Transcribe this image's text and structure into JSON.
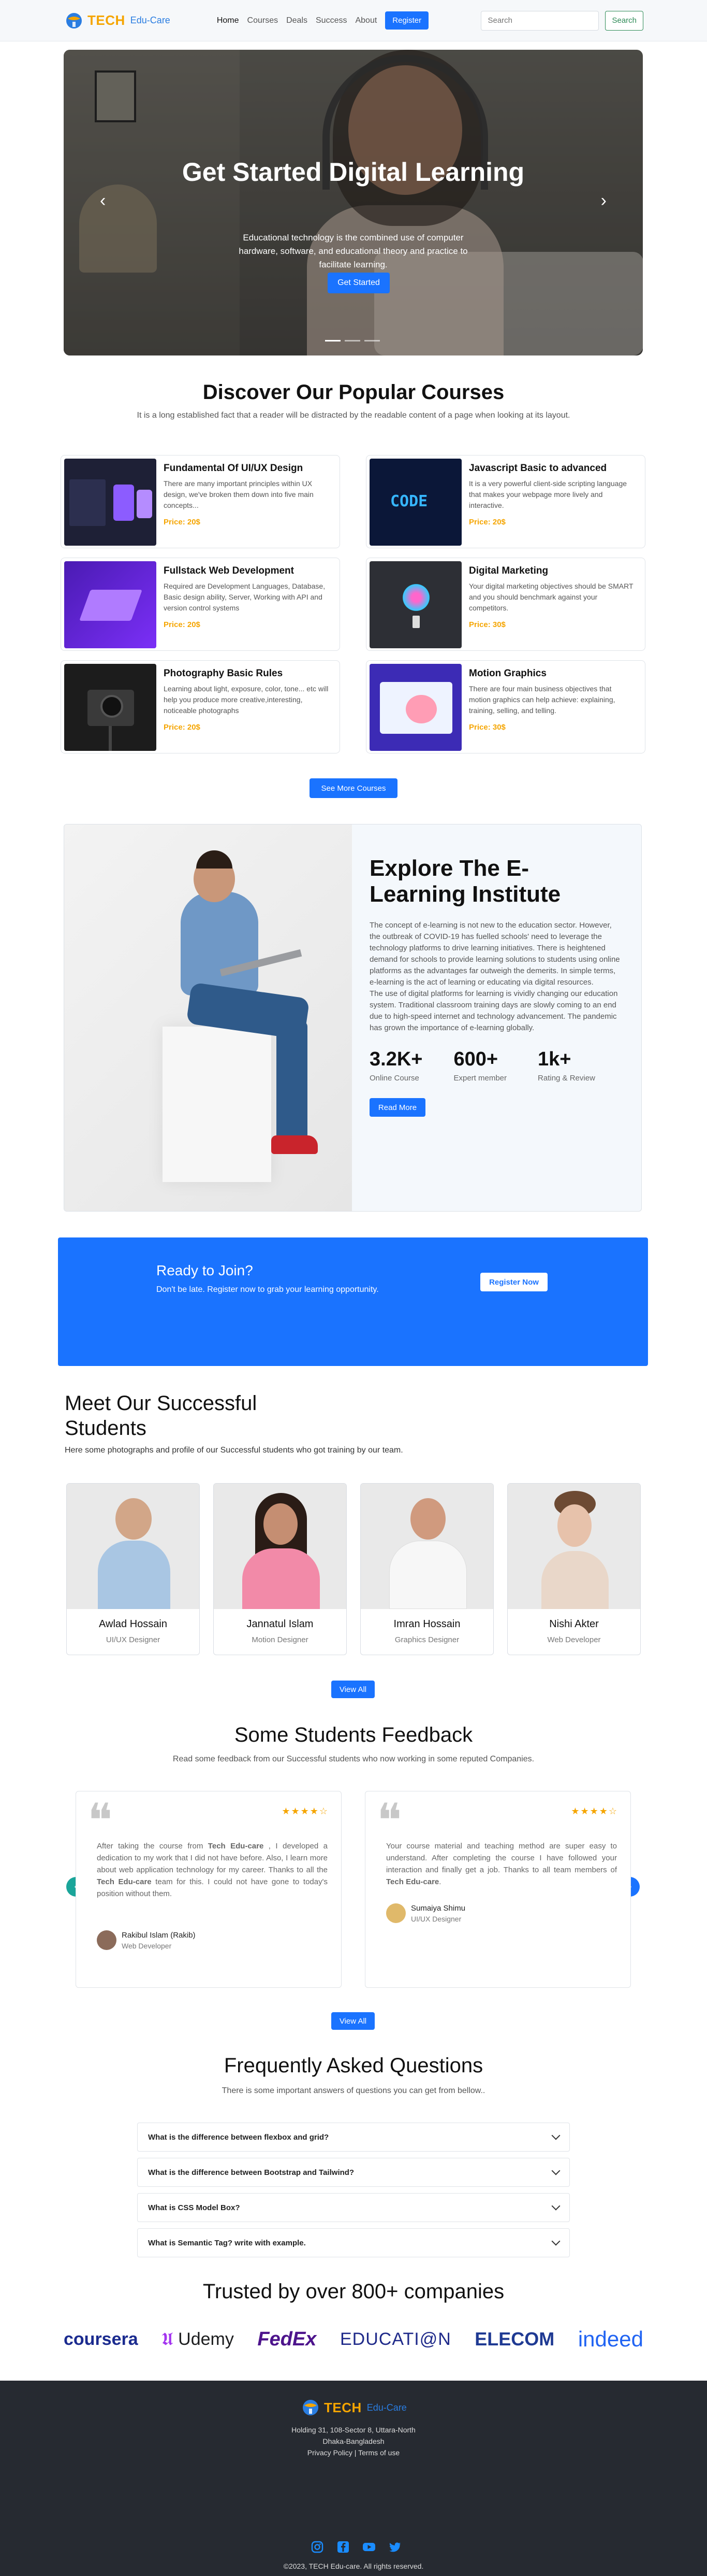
{
  "nav": {
    "logo_text": "TECH",
    "logo_sub": "Edu-Care",
    "links": [
      "Home",
      "Courses",
      "Deals",
      "Success",
      "About"
    ],
    "register": "Register",
    "search_placeholder": "Search",
    "search_button": "Search"
  },
  "hero": {
    "title": "Get Started Digital Learning",
    "text": "Educational technology is the combined use of computer hardware, software, and educational theory and practice to facilitate learning.",
    "cta": "Get Started"
  },
  "courses": {
    "title": "Discover Our Popular Courses",
    "subtitle": "It is a long established fact that a reader will be distracted by the readable content of a page when looking at its layout.",
    "items": [
      {
        "title": "Fundamental Of UI/UX Design",
        "desc": "There are many important principles within UX design, we've broken them down into five main concepts...",
        "price": "Price: 20$"
      },
      {
        "title": "Javascript Basic to advanced",
        "desc": "It is a very powerful client-side scripting language that makes your webpage more lively and interactive.",
        "price": "Price: 20$"
      },
      {
        "title": "Fullstack Web Development",
        "desc": "Required are Development Languages, Database, Basic design ability, Server, Working with API and version control systems",
        "price": "Price: 20$"
      },
      {
        "title": "Digital Marketing",
        "desc": "Your digital marketing objectives should be SMART and you should benchmark against your competitors.",
        "price": "Price: 30$"
      },
      {
        "title": "Photography Basic Rules",
        "desc": "Learning about light, exposure, color, tone... etc will help you produce more creative,interesting, noticeable photographs",
        "price": "Price: 20$"
      },
      {
        "title": "Motion Graphics",
        "desc": "There are four main business objectives that motion graphics can help achieve: explaining, training, selling, and telling.",
        "price": "Price: 30$"
      }
    ],
    "thumb_code_label": "CODE",
    "more": "See More Courses"
  },
  "elearn": {
    "title": "Explore The E-Learning Institute",
    "text": "The concept of e-learning is not new to the education sector. However, the outbreak of COVID-19 has fuelled schools' need to leverage the technology platforms to drive learning initiatives. There is heightened demand for schools to provide learning solutions to students using online platforms as the advantages far outweigh the demerits. In simple terms, e-learning is the act of learning or educating via digital resources.",
    "text2": "The use of digital platforms for learning is vividly changing our education system. Traditional classroom training days are slowly coming to an end due to high-speed internet and technology advancement. The pandemic has grown the importance of e-learning globally.",
    "stats": [
      {
        "n": "3.2K+",
        "l": "Online Course"
      },
      {
        "n": "600+",
        "l": "Expert member"
      },
      {
        "n": "1k+",
        "l": "Rating & Review"
      }
    ],
    "more": "Read More"
  },
  "ready": {
    "title": "Ready to Join?",
    "text": "Don't be late. Register now to grab your learning opportunity.",
    "button": "Register Now"
  },
  "students": {
    "title": "Meet Our Successful Students",
    "subtitle": "Here some photographs and profile of our Successful students who got training by our team.",
    "items": [
      {
        "name": "Awlad Hossain",
        "role": "UI/UX Designer"
      },
      {
        "name": "Jannatul Islam",
        "role": "Motion Designer"
      },
      {
        "name": "Imran Hossain",
        "role": "Graphics Designer"
      },
      {
        "name": "Nishi Akter",
        "role": "Web Developer"
      }
    ],
    "view_all": "View All"
  },
  "feedback": {
    "title": "Some Students Feedback",
    "subtitle": "Read some feedback from our Successful students who now working in some reputed Companies.",
    "items": [
      {
        "text_a": "After taking the course from ",
        "brand": "Tech Edu-care",
        "text_b": " , I developed a dedication to my work that I did not have before. Also, I learn more about web application technology for my career. Thanks to all the ",
        "brand2": "Tech Edu-care",
        "text_c": " team for this. I could not have gone to today's position without them.",
        "name": "Rakibul Islam (Rakib)",
        "role": "Web Developer",
        "stars": "★★★★☆"
      },
      {
        "text_a": "Your course material and teaching method are super easy to understand. After completing the course I have followed your interaction and finally get a job. Thanks to all team members of ",
        "brand": "Tech Edu-care",
        "text_b": ".",
        "name": "Sumaiya Shimu",
        "role": "UI/UX Designer",
        "stars": "★★★★☆"
      }
    ],
    "view_all": "View All"
  },
  "faq": {
    "title": "Frequently Asked Questions",
    "subtitle": "There is some important answers of questions you can get from bellow..",
    "items": [
      "What is the difference between flexbox and grid?",
      "What is the difference between Bootstrap and Tailwind?",
      "What is CSS Model Box?",
      "What is Semantic Tag? write with example."
    ]
  },
  "companies": {
    "title": "Trusted by over 800+ companies",
    "logos": [
      "coursera",
      "Udemy",
      "FedEx",
      "EDUCATI@N",
      "ELECOM",
      "indeed"
    ]
  },
  "footer": {
    "address": "Holding 31, 108-Sector 8, Uttara-North",
    "city": "Dhaka-Bangladesh",
    "policy": "Privacy Policy | Terms of use",
    "copyright": "©2023, TECH Edu-care. All rights reserved."
  },
  "colors": {
    "accent": "#1a73ff",
    "brand_orange": "#f5a500",
    "footer_bg": "#262a31"
  }
}
